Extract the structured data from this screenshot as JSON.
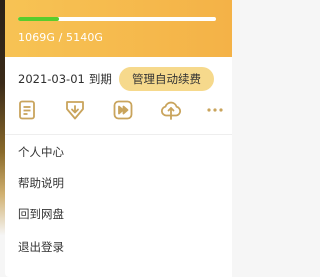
{
  "storage": {
    "used": "1069G",
    "total": "5140G",
    "usage_text": "1069G / 5140G",
    "used_fraction": 0.208,
    "bar_color": "#59cc2c"
  },
  "membership": {
    "expire_date": "2021-03-01",
    "expire_suffix": "到期",
    "renew_label": "管理自动续费"
  },
  "quick_icons": [
    {
      "icon": "document-icon"
    },
    {
      "icon": "download-shield-icon"
    },
    {
      "icon": "fast-forward-icon"
    },
    {
      "icon": "cloud-upload-icon"
    },
    {
      "icon": "more-icon"
    }
  ],
  "menu": {
    "items": [
      {
        "label": "个人中心"
      },
      {
        "label": "帮助说明"
      },
      {
        "label": "回到网盘"
      },
      {
        "label": "退出登录"
      }
    ]
  },
  "colors": {
    "header": "#f5b84c",
    "accent_icon": "#c9a45c",
    "renew_button": "#f6d98c"
  }
}
